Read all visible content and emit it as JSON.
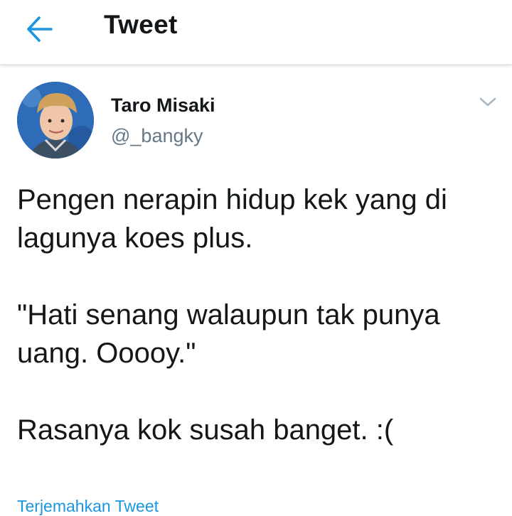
{
  "header": {
    "title": "Tweet",
    "back_icon": "arrow-left-icon",
    "accent_color": "#1b95e0"
  },
  "tweet": {
    "author": {
      "display_name": "Taro Misaki",
      "handle": "@_bangky"
    },
    "menu_icon": "chevron-down-icon",
    "text_lines": [
      "Pengen nerapin hidup kek yang di",
      "lagunya koes plus.",
      "\"Hati senang walaupun tak punya",
      "uang. Ooooy.\"",
      "Rasanya kok susah banget. :("
    ],
    "translate_link": "Terjemahkan Tweet"
  }
}
